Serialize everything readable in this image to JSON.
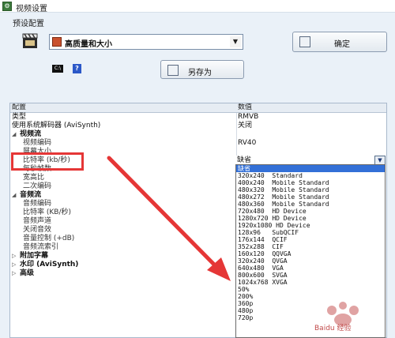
{
  "window": {
    "title": "视频设置"
  },
  "preset": {
    "label": "预设配置",
    "selected": "高质量和大小"
  },
  "buttons": {
    "confirm": "确定",
    "save_as": "另存为"
  },
  "grid": {
    "header": {
      "name": "配置",
      "value": "数值"
    },
    "rows": [
      {
        "name": "类型",
        "value": "RMVB",
        "kind": "item"
      },
      {
        "name": "使用系统解码器 (AviSynth)",
        "value": "关闭",
        "kind": "item"
      },
      {
        "name": "视频流",
        "value": "",
        "kind": "group",
        "expanded": true
      },
      {
        "name": "视频编码",
        "value": "RV40",
        "kind": "sub"
      },
      {
        "name": "屏幕大小",
        "value": "",
        "kind": "sub"
      },
      {
        "name": "比特率 (kb/秒)",
        "value": "",
        "kind": "sub"
      },
      {
        "name": "每秒帧数",
        "value": "",
        "kind": "sub"
      },
      {
        "name": "宽高比",
        "value": "",
        "kind": "sub"
      },
      {
        "name": "二次编码",
        "value": "",
        "kind": "sub"
      },
      {
        "name": "音频流",
        "value": "",
        "kind": "group",
        "expanded": true
      },
      {
        "name": "音频编码",
        "value": "",
        "kind": "sub"
      },
      {
        "name": "比特率 (KB/秒)",
        "value": "",
        "kind": "sub"
      },
      {
        "name": "音频声道",
        "value": "",
        "kind": "sub"
      },
      {
        "name": "关闭音效",
        "value": "",
        "kind": "sub"
      },
      {
        "name": "音量控制 (+dB)",
        "value": "",
        "kind": "sub"
      },
      {
        "name": "音频流索引",
        "value": "",
        "kind": "sub"
      },
      {
        "name": "附加字幕",
        "value": "",
        "kind": "group",
        "expanded": false
      },
      {
        "name": "水印 (AviSynth)",
        "value": "",
        "kind": "group",
        "expanded": false
      },
      {
        "name": "高级",
        "value": "",
        "kind": "group",
        "expanded": false
      }
    ]
  },
  "screen_size": {
    "current": "缺省",
    "options": [
      "缺省",
      "320x240  Standard",
      "400x240  Mobile Standard",
      "480x320  Mobile Standard",
      "480x272  Mobile Standard",
      "480x360  Mobile Standard",
      "720x480  HD Device",
      "1280x720 HD Device",
      "1920x1080 HD Device",
      "128x96   SubQCIF",
      "176x144  QCIF",
      "352x288  CIF",
      "160x120  QQVGA",
      "320x240  QVGA",
      "640x480  VGA",
      "800x600  SVGA",
      "1024x768 XVGA",
      "50%",
      "200%",
      "360p",
      "480p",
      "720p"
    ],
    "selected_index": 0
  },
  "watermark": {
    "text": "Baidu 经验"
  },
  "colors": {
    "highlight": "#e53636",
    "arrow": "#e53636",
    "selection": "#3370d7"
  },
  "icons": {
    "app": "settings-icon",
    "film": "film-clapper-icon",
    "confirm": "confirm-icon",
    "save_as": "save-icon",
    "cmd": "command-prompt-icon",
    "help": "help-icon"
  }
}
